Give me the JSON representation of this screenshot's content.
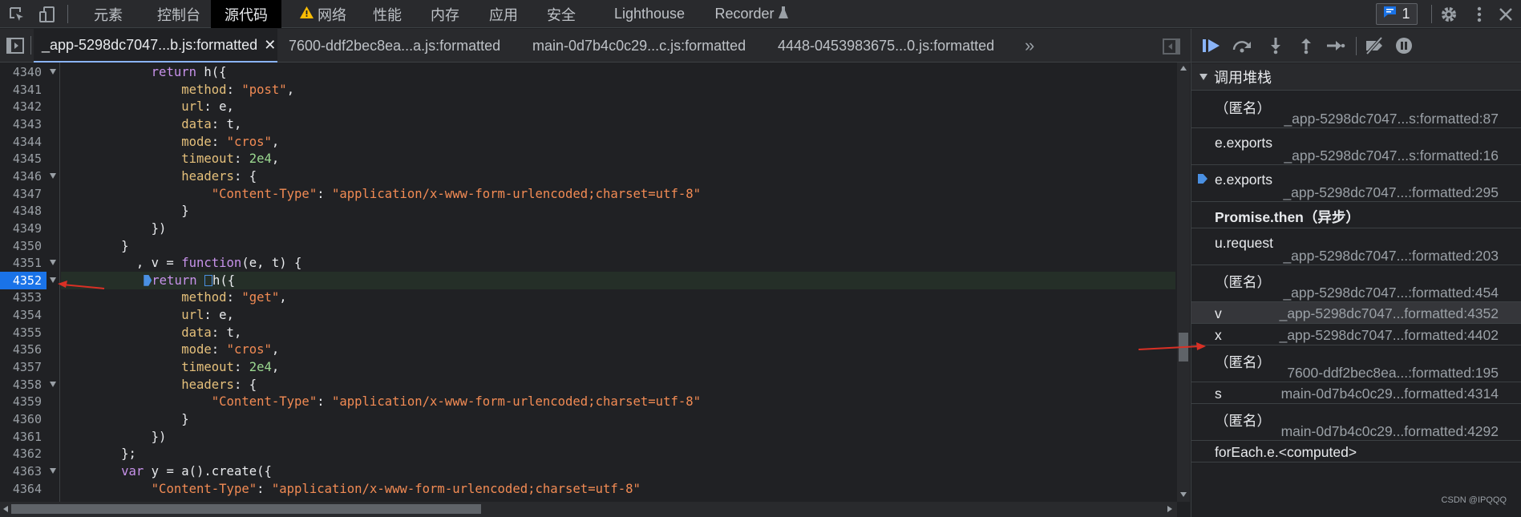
{
  "toolbar": {
    "tabs": [
      "元素",
      "控制台",
      "源代码",
      "网络",
      "性能",
      "内存",
      "应用",
      "安全",
      "Lighthouse",
      "Recorder"
    ],
    "issues_count": "1"
  },
  "file_tabs": [
    "_app-5298dc7047...b.js:formatted",
    "7600-ddf2bec8ea...a.js:formatted",
    "main-0d7b4c0c29...c.js:formatted",
    "4448-0453983675...0.js:formatted"
  ],
  "code": {
    "lines": [
      {
        "num": "4340",
        "fold": true,
        "t": "            return h({"
      },
      {
        "num": "4341",
        "fold": false,
        "t": "                method: \"post\","
      },
      {
        "num": "4342",
        "fold": false,
        "t": "                url: e,"
      },
      {
        "num": "4343",
        "fold": false,
        "t": "                data: t,"
      },
      {
        "num": "4344",
        "fold": false,
        "t": "                mode: \"cros\","
      },
      {
        "num": "4345",
        "fold": false,
        "t": "                timeout: 2e4,"
      },
      {
        "num": "4346",
        "fold": true,
        "t": "                headers: {"
      },
      {
        "num": "4347",
        "fold": false,
        "t": "                    \"Content-Type\": \"application/x-www-form-urlencoded;charset=utf-8\""
      },
      {
        "num": "4348",
        "fold": false,
        "t": "                }"
      },
      {
        "num": "4349",
        "fold": false,
        "t": "            })"
      },
      {
        "num": "4350",
        "fold": false,
        "t": "        }"
      },
      {
        "num": "4351",
        "fold": true,
        "t": "          , v = function(e, t) {"
      },
      {
        "num": "4352",
        "fold": true,
        "t": "            return h({"
      },
      {
        "num": "4353",
        "fold": false,
        "t": "                method: \"get\","
      },
      {
        "num": "4354",
        "fold": false,
        "t": "                url: e,"
      },
      {
        "num": "4355",
        "fold": false,
        "t": "                data: t,"
      },
      {
        "num": "4356",
        "fold": false,
        "t": "                mode: \"cros\","
      },
      {
        "num": "4357",
        "fold": false,
        "t": "                timeout: 2e4,"
      },
      {
        "num": "4358",
        "fold": true,
        "t": "                headers: {"
      },
      {
        "num": "4359",
        "fold": false,
        "t": "                    \"Content-Type\": \"application/x-www-form-urlencoded;charset=utf-8\""
      },
      {
        "num": "4360",
        "fold": false,
        "t": "                }"
      },
      {
        "num": "4361",
        "fold": false,
        "t": "            })"
      },
      {
        "num": "4362",
        "fold": false,
        "t": "        };"
      },
      {
        "num": "4363",
        "fold": true,
        "t": "        var y = a().create({"
      },
      {
        "num": "4364",
        "fold": false,
        "t": "            \"Content-Type\": \"application/x-www-form-urlencoded;charset=utf-8\""
      }
    ],
    "breakpoint_line": "4352"
  },
  "debugger": {
    "section_title": "调用堆栈",
    "frames": [
      {
        "name": "（匿名）",
        "loc": "_app-5298dc7047...s:formatted:87",
        "same_line": false
      },
      {
        "name": "e.exports",
        "loc": "_app-5298dc7047...s:formatted:16",
        "same_line": false
      },
      {
        "name": "e.exports",
        "loc": "_app-5298dc7047...:formatted:295",
        "same_line": false,
        "current": true
      },
      {
        "name": "Promise.then（异步）",
        "loc": "",
        "async": true
      },
      {
        "name": "u.request",
        "loc": "_app-5298dc7047...:formatted:203",
        "same_line": false
      },
      {
        "name": "（匿名）",
        "loc": "_app-5298dc7047...:formatted:454",
        "same_line": false
      },
      {
        "name": "v",
        "loc": "_app-5298dc7047...formatted:4352",
        "same_line": true,
        "selected": true
      },
      {
        "name": "x",
        "loc": "_app-5298dc7047...formatted:4402",
        "same_line": true
      },
      {
        "name": "（匿名）",
        "loc": "7600-ddf2bec8ea...:formatted:195",
        "same_line": false
      },
      {
        "name": "s",
        "loc": "main-0d7b4c0c29...formatted:4314",
        "same_line": true
      },
      {
        "name": "（匿名）",
        "loc": "main-0d7b4c0c29...formatted:4292",
        "same_line": false
      },
      {
        "name": "forEach.e.<computed>",
        "loc": "",
        "same_line": true
      }
    ]
  },
  "watermark": "CSDN @IPQQQ",
  "colors": {
    "accent": "#8ab4f8",
    "breakpoint": "#1a73e8",
    "annotation_arrow": "#d93025",
    "warning": "#fbbc04"
  }
}
